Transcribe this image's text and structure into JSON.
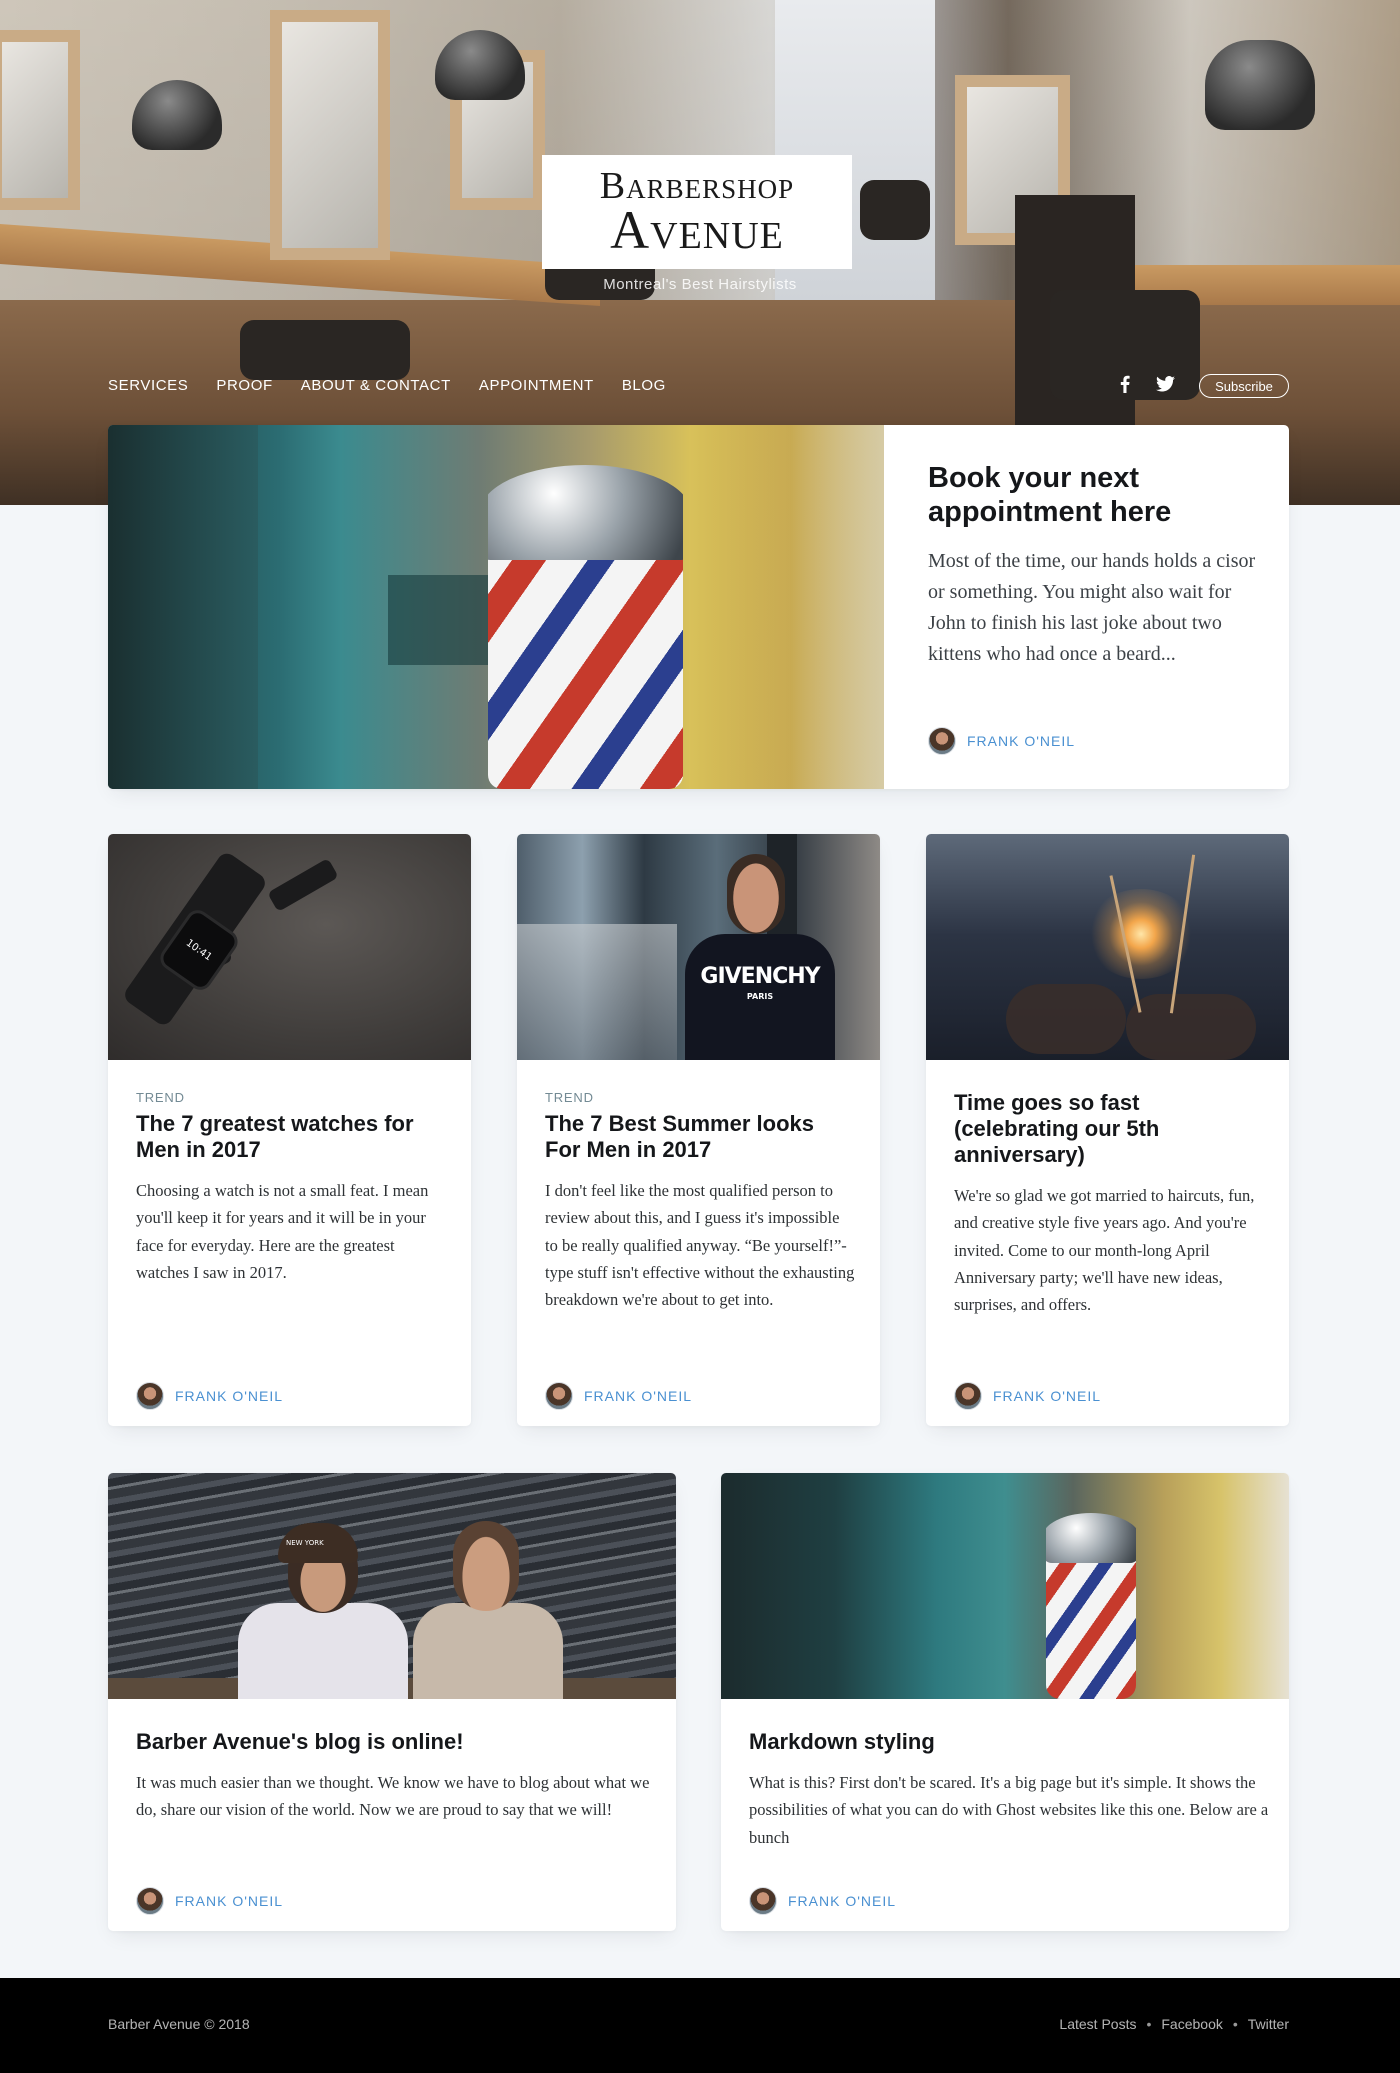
{
  "site": {
    "title_line1": "Barbershop",
    "title_line2": "Avenue",
    "tagline": "Montreal's Best Hairstylists"
  },
  "nav": {
    "items": [
      "Services",
      "Proof",
      "About & Contact",
      "Appointment",
      "Blog"
    ],
    "subscribe_label": "Subscribe"
  },
  "social": [
    "facebook-icon",
    "twitter-icon"
  ],
  "featured": {
    "title": "Book your next appointment here",
    "excerpt": "Most of the time, our hands holds a cisor or something. You might also wait for John to finish his last joke about two kittens who had once a beard...",
    "author": "Frank O'Neil"
  },
  "posts": [
    {
      "tag": "Trend",
      "title": "The 7 greatest watches for Men in 2017",
      "excerpt": "Choosing a watch is not a small feat. I mean you'll keep it for years and it will be in your face for everyday. Here are the greatest watches I saw in 2017.",
      "author": "Frank O'Neil"
    },
    {
      "tag": "Trend",
      "title": "The 7 Best Summer looks For Men in 2017",
      "excerpt": "I don't feel like the most qualified person to review about this, and I guess it's impossible to be really qualified anyway. “Be yourself!”-type stuff isn't effective without the exhausting breakdown we're about to get into.",
      "author": "Frank O'Neil"
    },
    {
      "tag": "",
      "title": "Time goes so fast (celebrating our 5th anniversary)",
      "excerpt": "We're so glad we got married to haircuts, fun, and creative style five years ago. And you're invited. Come to our month-long April Anniversary party; we'll have new ideas, surprises, and offers.",
      "author": "Frank O'Neil"
    },
    {
      "title": "Barber Avenue's blog is online!",
      "excerpt": "It was much easier than we thought. We know we have to blog about what we do, share our vision of the world. Now we are proud to say that we will!",
      "author": "Frank O'Neil"
    },
    {
      "title": "Markdown styling",
      "excerpt": "What is this? First don't be scared. It's a big page but it's simple. It shows the possibilities of what you can do with Ghost websites like this one. Below are a bunch",
      "author": "Frank O'Neil"
    }
  ],
  "watch_time": "10:41",
  "shirt_text": "GIVENCHY",
  "shirt_subtext": "PARIS",
  "cap_text": "NEW YORK",
  "footer": {
    "copyright": "Barber Avenue © 2018",
    "links": [
      "Latest Posts",
      "Facebook",
      "Twitter"
    ]
  },
  "colors": {
    "background": "#f3f6f9",
    "author_link": "#4a90d1",
    "footer": "#000000"
  }
}
